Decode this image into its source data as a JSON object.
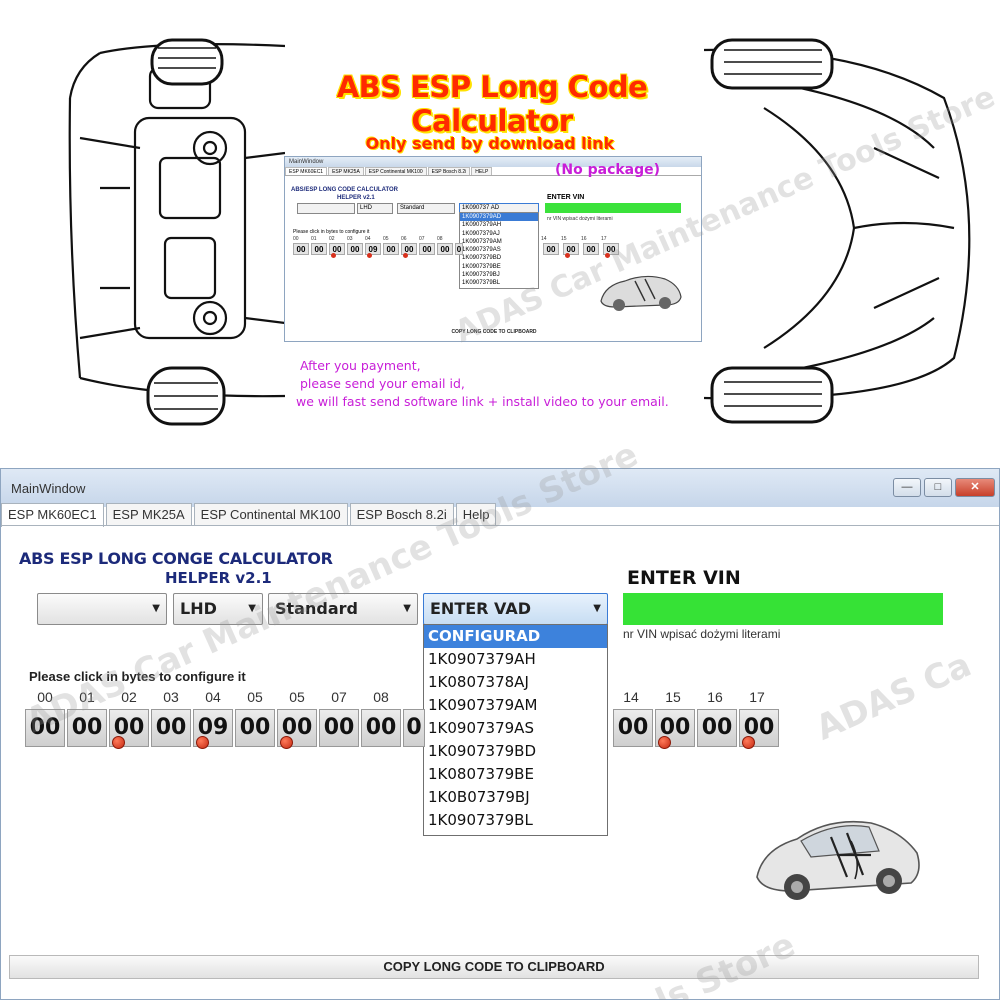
{
  "promo": {
    "title": "ABS ESP Long Code Calculator",
    "subtitle": "Only send by download link",
    "no_package": "(No package)",
    "payment_lines": [
      "After you payment,",
      "please send your email id,",
      "we will fast send software link + install video to your email."
    ]
  },
  "mini_window": {
    "title": "MainWindow",
    "tabs": [
      "ESP MK60EC1",
      "ESP MK25A",
      "ESP Continental MK100",
      "ESP Bosch 8.2i",
      "HELP"
    ],
    "heading": "ABS/ESP LONG CODE CALCULATOR",
    "helper": "HELPER v2.1",
    "combo_1": "",
    "combo_2": "LHD",
    "combo_3": "Standard",
    "combo_4": "1K090737 AD",
    "enter_vin": "ENTER VIN",
    "vin_hint": "nr VIN wpisać dożymi literami",
    "configure_hint": "Please click in bytes to configure it",
    "indices": [
      "00",
      "01",
      "02",
      "03",
      "04",
      "05",
      "06",
      "07",
      "08",
      "14",
      "15",
      "16",
      "17"
    ],
    "bytes": [
      "00",
      "00",
      "00",
      "00",
      "09",
      "00",
      "00",
      "00",
      "00",
      "0",
      "00",
      "00",
      "00",
      "00"
    ],
    "dropdown": [
      "1K0907379AD",
      "1K0907379AH",
      "1K0907379AJ",
      "1K0907379AM",
      "1K0907379AS",
      "1K0907379BD",
      "1K0907379BE",
      "1K0907379BJ",
      "1K0907379BL"
    ],
    "copy_button": "COPY LONG CODE TO CLIPBOARD"
  },
  "window": {
    "title": "MainWindow",
    "controls": {
      "minimize": "—",
      "maximize": "□",
      "close": "✕"
    },
    "tabs": [
      "ESP MK60EC1",
      "ESP MK25A",
      "ESP Continental MK100",
      "ESP Bosch 8.2i",
      "Help"
    ],
    "heading": "ABS ESP LONG CONGE CALCULATOR",
    "helper": "HELPER v2.1",
    "combo_1": "",
    "combo_2": "LHD",
    "combo_3": "Standard",
    "combo_4": "ENTER VAD",
    "enter_vin": "ENTER VIN",
    "vin_hint": "nr VIN wpisać dożymi literami",
    "configure_hint": "Please click in bytes to configure it",
    "indices": [
      "00",
      "01",
      "02",
      "03",
      "04",
      "05",
      "05",
      "07",
      "08",
      "14",
      "15",
      "16",
      "17"
    ],
    "bytes": [
      "00",
      "00",
      "00",
      "00",
      "09",
      "00",
      "00",
      "00",
      "00",
      "0",
      "00",
      "00",
      "00",
      "00"
    ],
    "dropdown": [
      "CONFIGURAD",
      "1K0907379AH",
      "1K0807378AJ",
      "1K0907379AM",
      "1K0907379AS",
      "1K0907379BD",
      "1K0807379BE",
      "1K0B07379BJ",
      "1K0907379BL"
    ],
    "copy_button": "COPY LONG CODE TO CLIPBOARD"
  },
  "watermarks": [
    "ADAS Car Maintenance Tools Store",
    "ADAS Car Maintenance Tools Store",
    "ADAS Ca",
    "ls Store"
  ],
  "colors": {
    "title_red": "#ff2a00",
    "title_yellow": "#ffe100",
    "purple": "#c81ed8",
    "vin_green": "#36e236",
    "heading_navy": "#1c2a7a",
    "select_blue": "#3d82dc"
  },
  "icons": [
    "car-schematic-left",
    "car-schematic-right",
    "car-photo"
  ]
}
